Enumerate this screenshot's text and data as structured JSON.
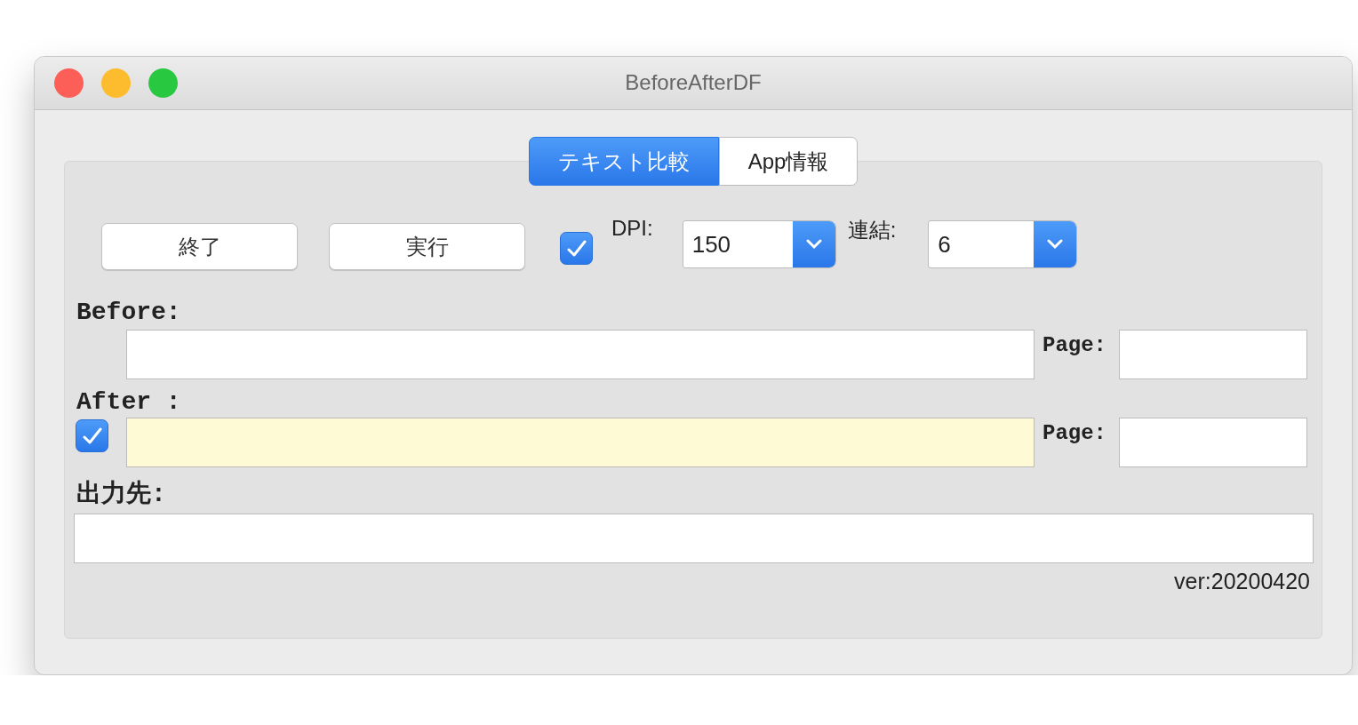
{
  "window": {
    "title": "BeforeAfterDF"
  },
  "tabs": [
    {
      "label": "テキスト比較",
      "selected": true
    },
    {
      "label": "App情報",
      "selected": false
    }
  ],
  "toolbar": {
    "buttons": [
      "終了",
      "実行"
    ],
    "option": {
      "checked": true
    },
    "dpi": {
      "label": "DPI:",
      "value": "150"
    },
    "link": {
      "label": "連結:",
      "value": "6"
    }
  },
  "before": {
    "label": "Before:",
    "page_label": "Page:"
  },
  "after": {
    "label": "After :",
    "checked": true,
    "page_label": "Page:"
  },
  "output": {
    "label": "出力先:"
  },
  "version": "ver:20200420"
}
